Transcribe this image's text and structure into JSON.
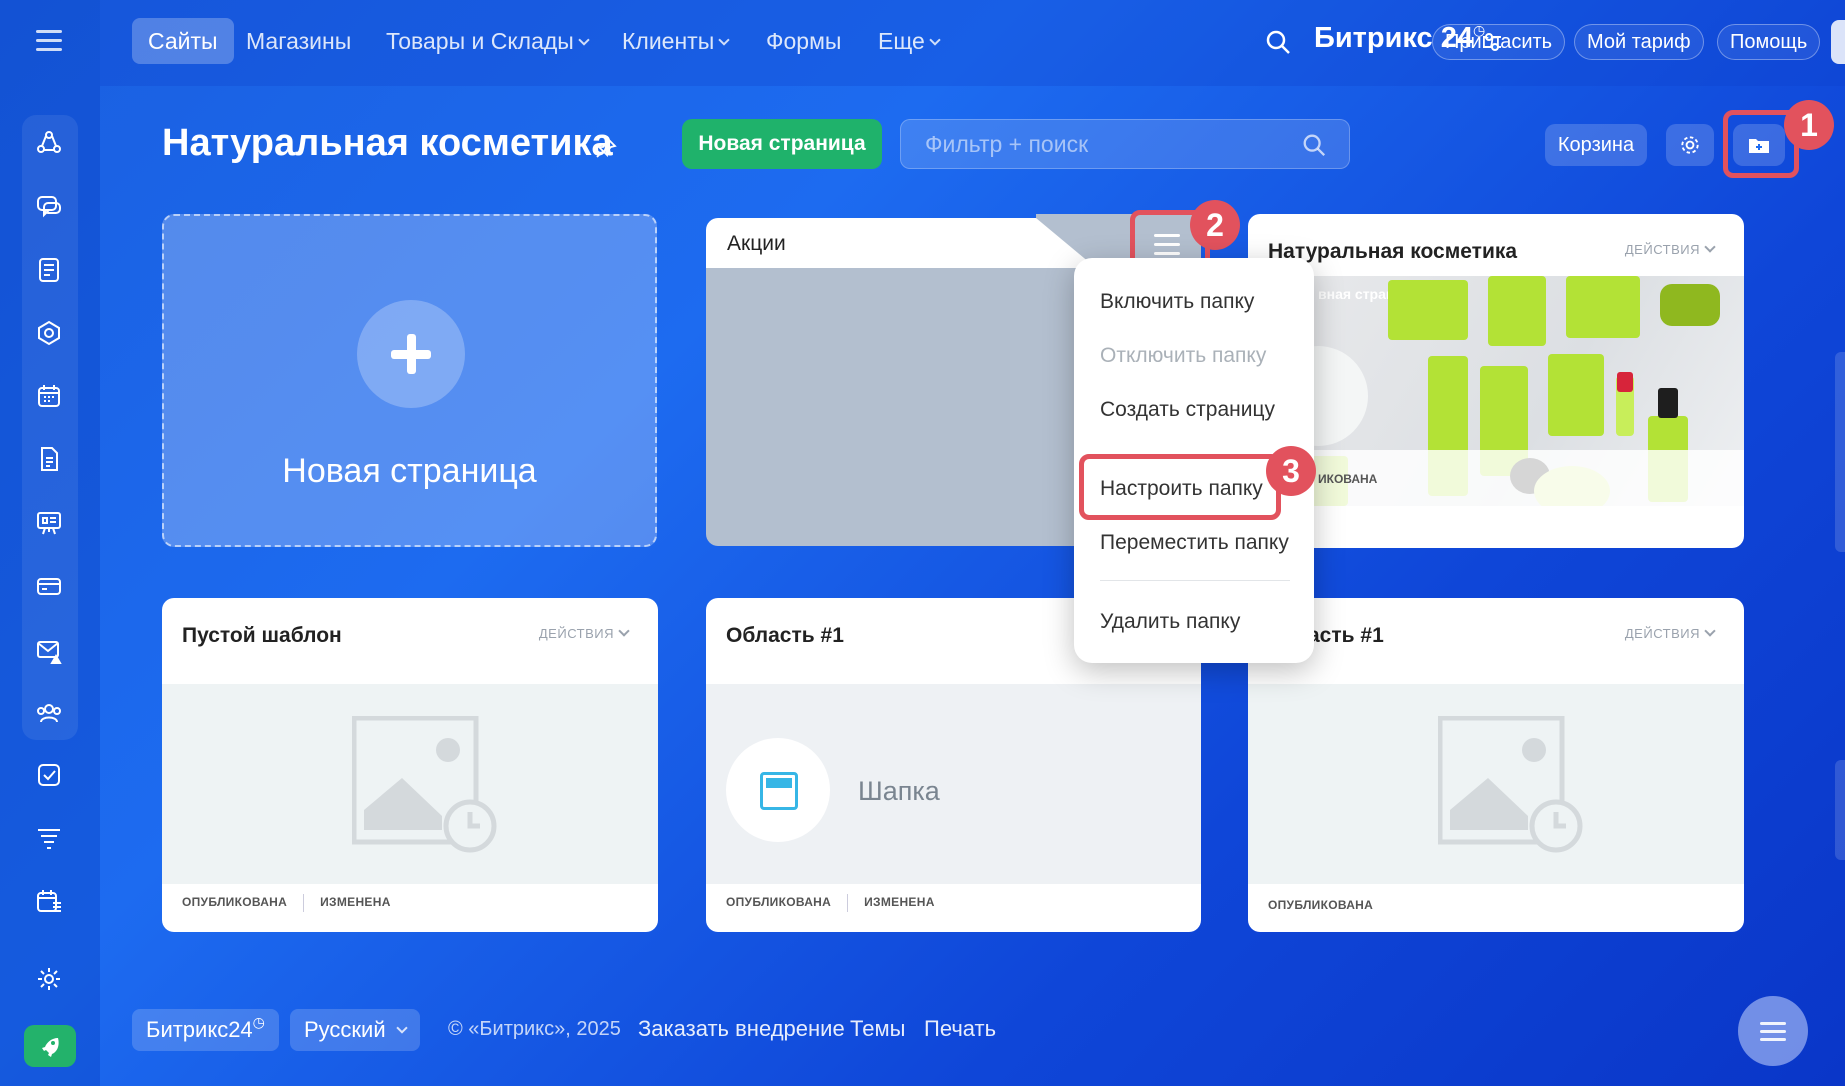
{
  "nav": {
    "items": [
      {
        "label": "Сайты",
        "active": true,
        "dropdown": false
      },
      {
        "label": "Магазины",
        "active": false,
        "dropdown": false
      },
      {
        "label": "Товары и Склады",
        "active": false,
        "dropdown": true
      },
      {
        "label": "Клиенты",
        "active": false,
        "dropdown": true
      },
      {
        "label": "Формы",
        "active": false,
        "dropdown": false
      },
      {
        "label": "Еще",
        "active": false,
        "dropdown": true
      }
    ],
    "brand": "Битрикс 24",
    "invite": "Пригласить",
    "tariff": "Мой тариф",
    "help": "Помощь"
  },
  "header": {
    "title": "Натуральная косметика",
    "new_page_button": "Новая страница",
    "filter_placeholder": "Фильтр + поиск",
    "bin_button": "Корзина"
  },
  "annotations": [
    "1",
    "2",
    "3"
  ],
  "cards": {
    "new_page": "Новая страница",
    "folder": {
      "title": "Акции"
    },
    "site": {
      "title": "Натуральная косметика",
      "actions": "ДЕЙСТВИЯ",
      "image_caption": "вная страница",
      "image_footer": "ИКОВАНА"
    },
    "empty_template": {
      "title": "Пустой шаблон",
      "actions": "ДЕЙСТВИЯ",
      "published": "ОПУБЛИКОВАНА",
      "changed": "ИЗМЕНЕНА"
    },
    "area1": {
      "title": "Область #1",
      "block_name": "Шапка",
      "published": "ОПУБЛИКОВАНА",
      "changed": "ИЗМЕНЕНА"
    },
    "area1_right": {
      "title": "асть #1",
      "actions": "ДЕЙСТВИЯ",
      "published": "ОПУБЛИКОВАНА"
    }
  },
  "dropdown": {
    "items": [
      {
        "label": "Включить папку",
        "disabled": false
      },
      {
        "label": "Отключить папку",
        "disabled": true
      },
      {
        "label": "Создать страницу",
        "disabled": false
      },
      {
        "label": "Настроить папку",
        "disabled": false
      },
      {
        "label": "Переместить папку",
        "disabled": false
      },
      {
        "label": "Удалить папку",
        "disabled": false
      }
    ]
  },
  "footer": {
    "brand": "Битрикс24",
    "language": "Русский",
    "copyright": "© «Битрикс», 2025",
    "order": "Заказать внедрение",
    "themes": "Темы",
    "print": "Печать"
  },
  "colors": {
    "accent_green": "#1fb26b",
    "highlight_red": "#e2525d",
    "background_blue": "#1d6bf0"
  }
}
